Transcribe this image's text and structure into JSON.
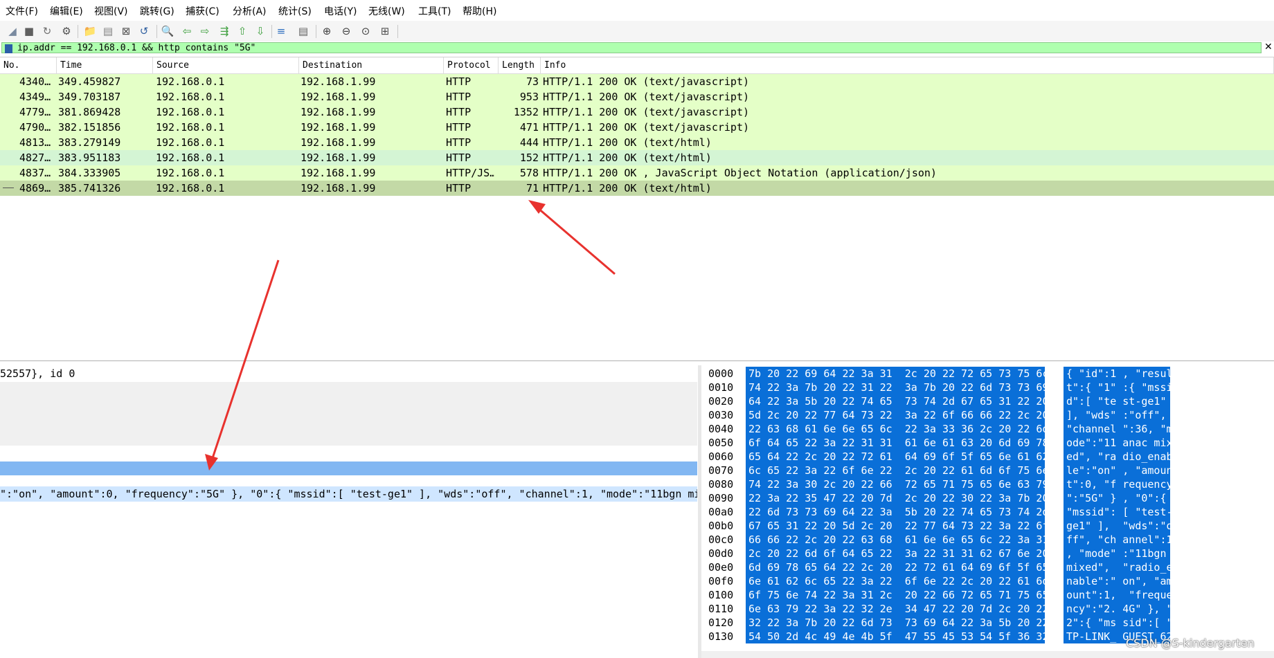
{
  "menu": [
    "文件(F)",
    "编辑(E)",
    "视图(V)",
    "跳转(G)",
    "捕获(C)",
    "分析(A)",
    "统计(S)",
    "电话(Y)",
    "无线(W)",
    "工具(T)",
    "帮助(H)"
  ],
  "toolbar_icons": [
    "shark-fin-start-icon",
    "stop-icon",
    "restart-icon",
    "capture-options-icon",
    "open-folder-icon",
    "save-file-icon",
    "close-file-icon",
    "reload-icon",
    "find-icon",
    "go-back-icon",
    "go-forward-icon",
    "go-to-packet-icon",
    "go-first-icon",
    "go-last-icon",
    "autoscroll-icon",
    "colorize-icon",
    "zoom-in-icon",
    "zoom-out-icon",
    "zoom-normal-icon",
    "resize-columns-icon"
  ],
  "filter": {
    "value": "ip.addr == 192.168.0.1 && http contains \"5G\"",
    "clear": "✕"
  },
  "columns": [
    "No.",
    "Time",
    "Source",
    "Destination",
    "Protocol",
    "Length",
    "Info"
  ],
  "packets": [
    {
      "no": "4340…",
      "time": "349.459827",
      "src": "192.168.0.1",
      "dst": "192.168.1.99",
      "proto": "HTTP",
      "len": "73",
      "info": "HTTP/1.1 200 OK  (text/javascript)"
    },
    {
      "no": "4349…",
      "time": "349.703187",
      "src": "192.168.0.1",
      "dst": "192.168.1.99",
      "proto": "HTTP",
      "len": "953",
      "info": "HTTP/1.1 200 OK  (text/javascript)"
    },
    {
      "no": "4779…",
      "time": "381.869428",
      "src": "192.168.0.1",
      "dst": "192.168.1.99",
      "proto": "HTTP",
      "len": "1352",
      "info": "HTTP/1.1 200 OK  (text/javascript)"
    },
    {
      "no": "4790…",
      "time": "382.151856",
      "src": "192.168.0.1",
      "dst": "192.168.1.99",
      "proto": "HTTP",
      "len": "471",
      "info": "HTTP/1.1 200 OK  (text/javascript)"
    },
    {
      "no": "4813…",
      "time": "383.279149",
      "src": "192.168.0.1",
      "dst": "192.168.1.99",
      "proto": "HTTP",
      "len": "444",
      "info": "HTTP/1.1 200 OK  (text/html)"
    },
    {
      "no": "4827…",
      "time": "383.951183",
      "src": "192.168.0.1",
      "dst": "192.168.1.99",
      "proto": "HTTP",
      "len": "152",
      "info": "HTTP/1.1 200 OK  (text/html)"
    },
    {
      "no": "4837…",
      "time": "384.333905",
      "src": "192.168.0.1",
      "dst": "192.168.1.99",
      "proto": "HTTP/JS…",
      "len": "578",
      "info": "HTTP/1.1 200 OK , JavaScript Object Notation (application/json)"
    },
    {
      "no": "4869…",
      "time": "385.741326",
      "src": "192.168.0.1",
      "dst": "192.168.1.99",
      "proto": "HTTP",
      "len": "71",
      "info": "HTTP/1.1 200 OK  (text/html)"
    }
  ],
  "colors": {
    "row_light": "#e4ffc7",
    "row_alt": "#d4f5d4",
    "row_selected": "#c3d9a6",
    "filter_ok": "#afffaf",
    "hex_sel": "#0a6fd8",
    "detail_sel": "#82b7f2",
    "detail_hl": "#cfe6ff",
    "arrow": "#e8322e"
  },
  "details": {
    "line1": "52557}, id 0",
    "selected_line": "\":\"on\", \"amount\":0, \"frequency\":\"5G\" }, \"0\":{ \"mssid\":[ \"test-ge1\" ], \"wds\":\"off\", \"channel\":1, \"mode\":\"11bgn mi"
  },
  "bytes": [
    {
      "off": "0000",
      "hex": "7b 20 22 69 64 22 3a 31  2c 20 22 72 65 73 75 6c",
      "ascii": "{ \"id\":1 , \"resul"
    },
    {
      "off": "0010",
      "hex": "74 22 3a 7b 20 22 31 22  3a 7b 20 22 6d 73 73 69",
      "ascii": "t\":{ \"1\" :{ \"mssi"
    },
    {
      "off": "0020",
      "hex": "64 22 3a 5b 20 22 74 65  73 74 2d 67 65 31 22 20",
      "ascii": "d\":[ \"te st-ge1\" "
    },
    {
      "off": "0030",
      "hex": "5d 2c 20 22 77 64 73 22  3a 22 6f 66 66 22 2c 20",
      "ascii": "], \"wds\" :\"off\", "
    },
    {
      "off": "0040",
      "hex": "22 63 68 61 6e 6e 65 6c  22 3a 33 36 2c 20 22 6d",
      "ascii": "\"channel \":36, \"m"
    },
    {
      "off": "0050",
      "hex": "6f 64 65 22 3a 22 31 31  61 6e 61 63 20 6d 69 78",
      "ascii": "ode\":\"11 anac mix"
    },
    {
      "off": "0060",
      "hex": "65 64 22 2c 20 22 72 61  64 69 6f 5f 65 6e 61 62",
      "ascii": "ed\", \"ra dio_enab"
    },
    {
      "off": "0070",
      "hex": "6c 65 22 3a 22 6f 6e 22  2c 20 22 61 6d 6f 75 6e",
      "ascii": "le\":\"on\" , \"amoun"
    },
    {
      "off": "0080",
      "hex": "74 22 3a 30 2c 20 22 66  72 65 71 75 65 6e 63 79",
      "ascii": "t\":0, \"f requency"
    },
    {
      "off": "0090",
      "hex": "22 3a 22 35 47 22 20 7d  2c 20 22 30 22 3a 7b 20",
      "ascii": "\":\"5G\" } , \"0\":{ "
    },
    {
      "off": "00a0",
      "hex": "22 6d 73 73 69 64 22 3a  5b 20 22 74 65 73 74 2d",
      "ascii": "\"mssid\": [ \"test-"
    },
    {
      "off": "00b0",
      "hex": "67 65 31 22 20 5d 2c 20  22 77 64 73 22 3a 22 6f",
      "ascii": "ge1\" ],  \"wds\":\"o"
    },
    {
      "off": "00c0",
      "hex": "66 66 22 2c 20 22 63 68  61 6e 6e 65 6c 22 3a 31",
      "ascii": "ff\", \"ch annel\":1"
    },
    {
      "off": "00d0",
      "hex": "2c 20 22 6d 6f 64 65 22  3a 22 31 31 62 67 6e 20",
      "ascii": ", \"mode\" :\"11bgn "
    },
    {
      "off": "00e0",
      "hex": "6d 69 78 65 64 22 2c 20  22 72 61 64 69 6f 5f 65",
      "ascii": "mixed\",  \"radio_e"
    },
    {
      "off": "00f0",
      "hex": "6e 61 62 6c 65 22 3a 22  6f 6e 22 2c 20 22 61 6d",
      "ascii": "nable\":\" on\", \"am"
    },
    {
      "off": "0100",
      "hex": "6f 75 6e 74 22 3a 31 2c  20 22 66 72 65 71 75 65",
      "ascii": "ount\":1,  \"freque"
    },
    {
      "off": "0110",
      "hex": "6e 63 79 22 3a 22 32 2e  34 47 22 20 7d 2c 20 22",
      "ascii": "ncy\":\"2. 4G\" }, \""
    },
    {
      "off": "0120",
      "hex": "32 22 3a 7b 20 22 6d 73  73 69 64 22 3a 5b 20 22",
      "ascii": "2\":{ \"ms sid\":[ \""
    },
    {
      "off": "0130",
      "hex": "54 50 2d 4c 49 4e 4b 5f  47 55 45 53 54 5f 36 32",
      "ascii": "TP-LINK_ GUEST_62"
    }
  ],
  "watermark": "CSDN @S-kindergarten"
}
